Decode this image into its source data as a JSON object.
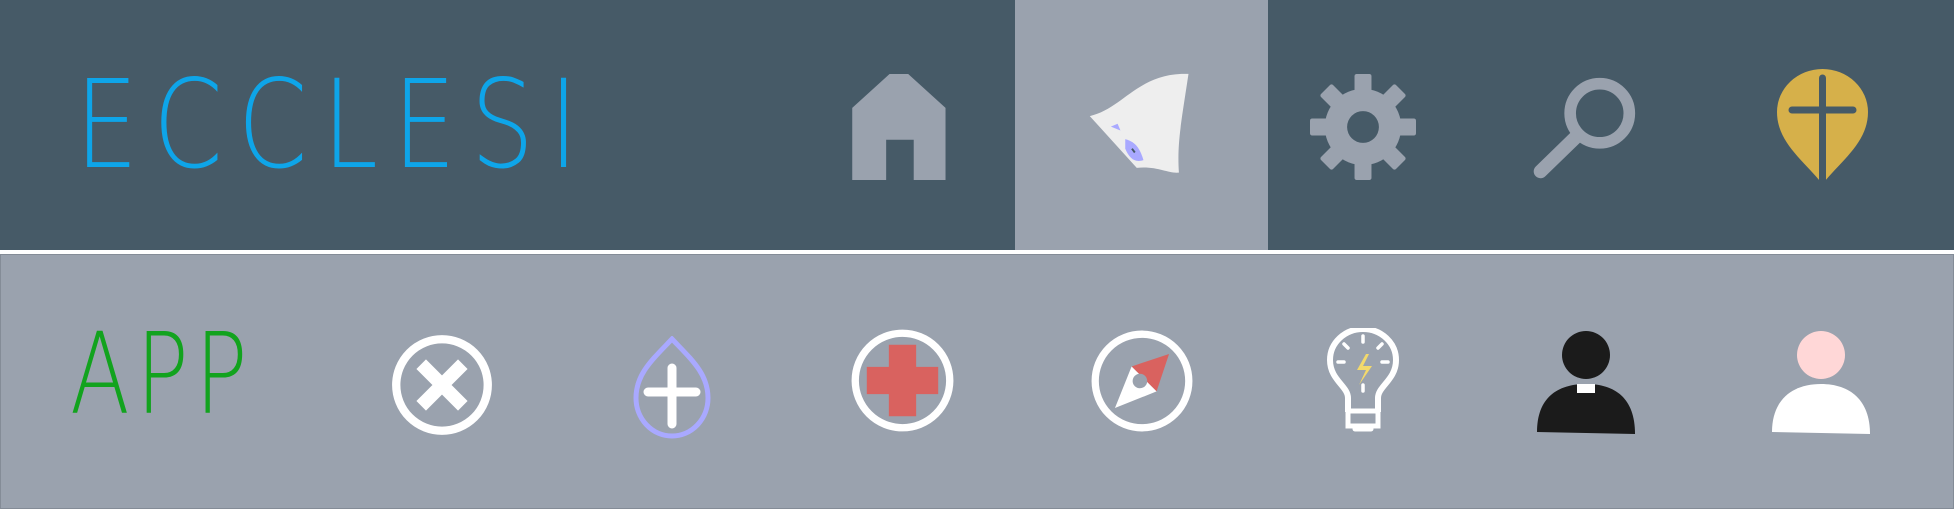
{
  "header": {
    "brand": "ECCLESI",
    "nav": [
      {
        "id": "home",
        "icon": "home-icon"
      },
      {
        "id": "prayer",
        "icon": "folded-hands-icon",
        "active": true
      },
      {
        "id": "settings",
        "icon": "gear-icon"
      },
      {
        "id": "search",
        "icon": "search-icon"
      },
      {
        "id": "church-location",
        "icon": "cross-map-pin-icon"
      }
    ]
  },
  "subheader": {
    "label": "APP",
    "icons": [
      {
        "id": "close",
        "icon": "close-circle-icon"
      },
      {
        "id": "holy-water",
        "icon": "cross-drop-icon"
      },
      {
        "id": "first-aid",
        "icon": "red-cross-circle-icon"
      },
      {
        "id": "compass",
        "icon": "compass-icon"
      },
      {
        "id": "idea",
        "icon": "lightbulb-icon"
      },
      {
        "id": "priest",
        "icon": "priest-icon"
      },
      {
        "id": "user",
        "icon": "user-icon"
      }
    ]
  },
  "colors": {
    "top_bar": "#465a67",
    "bottom_bar": "#9aa2ae",
    "brand": "#0ea5e9",
    "app_label": "#12a31e",
    "gold": "#d6b04a",
    "red": "#d9625f",
    "lavender": "#a9a9ff",
    "icon_gray": "#9aa2ae"
  }
}
